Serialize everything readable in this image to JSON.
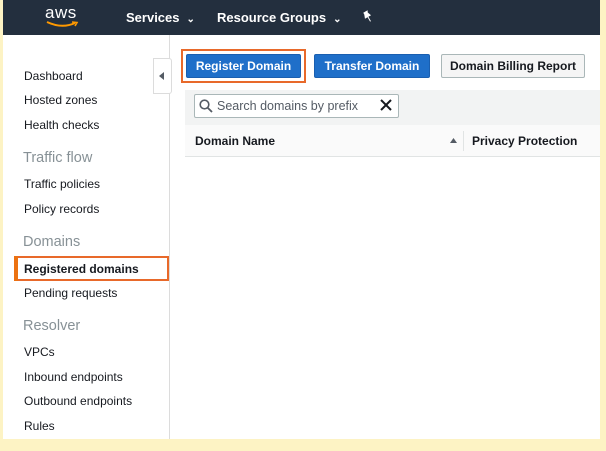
{
  "topbar": {
    "logo_text": "aws",
    "services_label": "Services",
    "resource_groups_label": "Resource Groups"
  },
  "sidebar": {
    "links_top": [
      "Dashboard",
      "Hosted zones",
      "Health checks"
    ],
    "section_traffic": "Traffic flow",
    "links_traffic": [
      "Traffic policies",
      "Policy records"
    ],
    "section_domains": "Domains",
    "active_item": "Registered domains",
    "links_domains": [
      "Pending requests"
    ],
    "section_resolver": "Resolver",
    "links_resolver": [
      "VPCs",
      "Inbound endpoints",
      "Outbound endpoints",
      "Rules"
    ]
  },
  "actions": {
    "register_label": "Register Domain",
    "transfer_label": "Transfer Domain",
    "billing_label": "Domain Billing Report"
  },
  "search": {
    "placeholder": "Search domains by prefix",
    "value": ""
  },
  "table": {
    "columns": [
      "Domain Name",
      "Privacy Protection"
    ],
    "sort_direction": "ascending",
    "rows": []
  },
  "colors": {
    "topbar_bg": "#232f3e",
    "primary_button": "#1f6fc9",
    "highlight_outline": "#e8692a",
    "page_border": "#fdf3c4"
  },
  "icons": [
    "aws-smile-logo",
    "chevron-down-icon",
    "pin-icon",
    "collapse-arrow-icon",
    "search-icon",
    "clear-icon",
    "sort-ascending-icon"
  ]
}
